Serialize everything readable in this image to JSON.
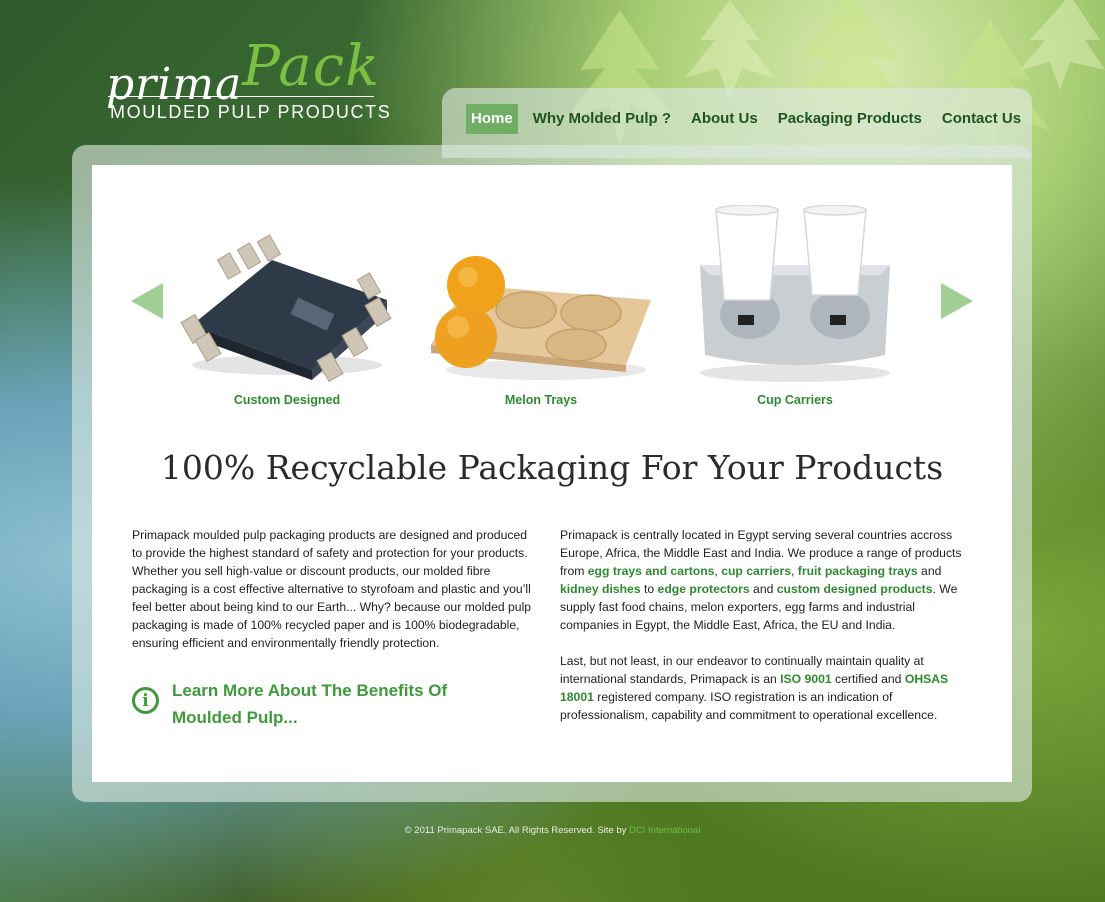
{
  "logo": {
    "script_main": "prima",
    "script_accent": "Pack",
    "subtitle": "MOULDED PULP PRODUCTS"
  },
  "nav": [
    {
      "label": "Home",
      "active": true
    },
    {
      "label": "Why Molded Pulp ?"
    },
    {
      "label": "About Us"
    },
    {
      "label": "Packaging Products"
    },
    {
      "label": "Contact Us"
    }
  ],
  "carousel": {
    "items": [
      {
        "caption": "Custom Designed"
      },
      {
        "caption": "Melon Trays"
      },
      {
        "caption": "Cup Carriers"
      }
    ]
  },
  "headline": "100% Recyclable Packaging For Your Products",
  "left_column": {
    "paragraph": "Primapack moulded pulp packaging products are designed and produced to provide the highest standard of safety and protection for your products. Whether you sell high-value or discount products, our molded fibre packaging is a cost effective alternative to styrofoam and plastic and you’ll feel better about being kind to our Earth... Why? because our molded pulp packaging is made of 100% recycled paper and is 100% biodegradable, ensuring efficient and environmentally friendly protection.",
    "info_link": "Learn More About The Benefits Of Moulded Pulp..."
  },
  "right_column": {
    "p1": {
      "t1": "Primapack is centrally located in Egypt serving several countries accross Europe, Africa, the Middle East and India. We produce a range of products from ",
      "l1": "egg trays and cartons",
      "t2": ", ",
      "l2": "cup carriers",
      "t3": ", ",
      "l3": "fruit packaging trays",
      "t4": " and ",
      "l4": "kidney dishes",
      "t5": " to ",
      "l5": "edge protectors",
      "t6": " and ",
      "l6": "custom designed products",
      "t7": ". We supply fast food chains, melon exporters, egg farms and industrial companies in Egypt, the Middle East, Africa, the EU and India."
    },
    "p2": {
      "t1": "Last, but not least, in our endeavor to continually maintain quality at international standards, Primapack is an ",
      "l1": "ISO 9001",
      "t2": " certified and ",
      "l2": "OHSAS 18001",
      "t3": " registered company. ISO registration is an indication of professionalism, capability and commitment to operational excellence."
    }
  },
  "footer": {
    "text": "© 2011 Primapack SAE. All Rights Reserved. Site by ",
    "credit": "DCI International"
  }
}
